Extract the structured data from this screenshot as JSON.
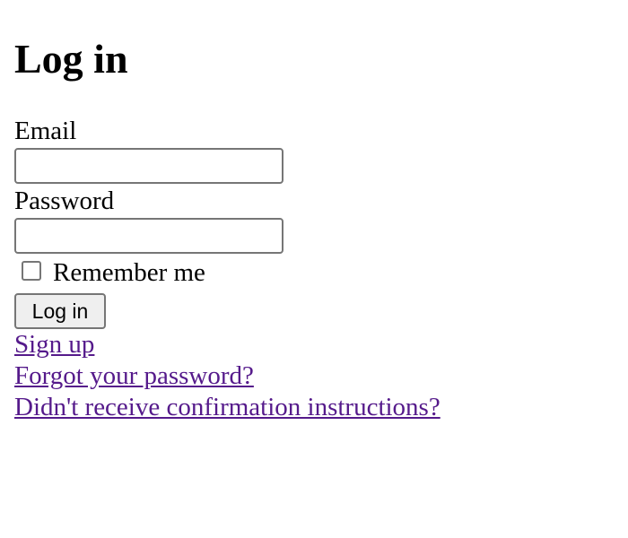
{
  "heading": "Log in",
  "form": {
    "email_label": "Email",
    "email_value": "",
    "password_label": "Password",
    "password_value": "",
    "remember_label": "Remember me",
    "remember_checked": false,
    "submit_label": "Log in"
  },
  "links": {
    "sign_up": "Sign up",
    "forgot_password": "Forgot your password?",
    "confirmation": "Didn't receive confirmation instructions?"
  },
  "colors": {
    "link_visited": "#551a8b",
    "input_border": "#767676",
    "button_bg": "#efefef"
  }
}
